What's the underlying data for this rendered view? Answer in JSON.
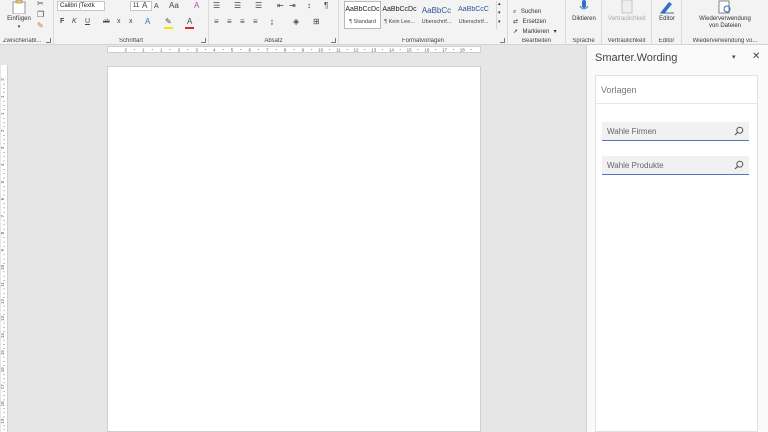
{
  "ribbon": {
    "clipboard": {
      "paste_label": "Einfügen",
      "group_label": "Zwischenabl..."
    },
    "font": {
      "font_name": "Calibri (Textk",
      "font_size": "11",
      "grow": "A",
      "shrink": "A",
      "case": "Aa",
      "bold": "F",
      "italic": "K",
      "underline": "U",
      "strike": "ab",
      "subscript": "x",
      "superscript": "x",
      "effects": "A",
      "fontcolor": "A",
      "group_label": "Schriftart"
    },
    "paragraph": {
      "pilcrow": "¶",
      "group_label": "Absatz"
    },
    "styles": {
      "tiles": [
        {
          "sample": "AaBbCcDc",
          "name": "¶ Standard"
        },
        {
          "sample": "AaBbCcDc",
          "name": "¶ Kein Lee..."
        },
        {
          "sample": "AaBbCc",
          "name": "Überschrif..."
        },
        {
          "sample": "AaBbCcC",
          "name": "Überschrif..."
        }
      ],
      "group_label": "Formatvorlagen"
    },
    "editing": {
      "find": "Suchen",
      "replace": "Ersetzen",
      "select": "Markieren",
      "group_label": "Bearbeiten"
    },
    "voice": {
      "dictate": "Diktieren",
      "group_label": "Sprache"
    },
    "sensitivity": {
      "label": "Vertraulichkeit",
      "group_label": "Vertraulichkeit"
    },
    "editor": {
      "label": "Editor",
      "group_label": "Editor"
    },
    "reuse": {
      "label_line1": "Wiederverwendung",
      "label_line2": "von Dateien",
      "group_label": "Wiederverwendung vo..."
    }
  },
  "ruler": {
    "h_ticks": [
      "2",
      "1",
      "1",
      "2",
      "3",
      "4",
      "5",
      "6",
      "7",
      "8",
      "9",
      "10",
      "11",
      "12",
      "13",
      "14",
      "15",
      "16",
      "17",
      "18"
    ],
    "v_ticks": [
      "2",
      "1",
      "1",
      "2",
      "3",
      "4",
      "5",
      "6",
      "7",
      "8",
      "9",
      "10",
      "11",
      "12",
      "13",
      "14",
      "15",
      "16",
      "17",
      "18",
      "19"
    ]
  },
  "pane": {
    "title": "Smarter.Wording",
    "menu": "▾",
    "close": "✕",
    "section": "Vorlagen",
    "search_companies": "Wahle Firmen",
    "search_products": "Wahle Produkte"
  }
}
